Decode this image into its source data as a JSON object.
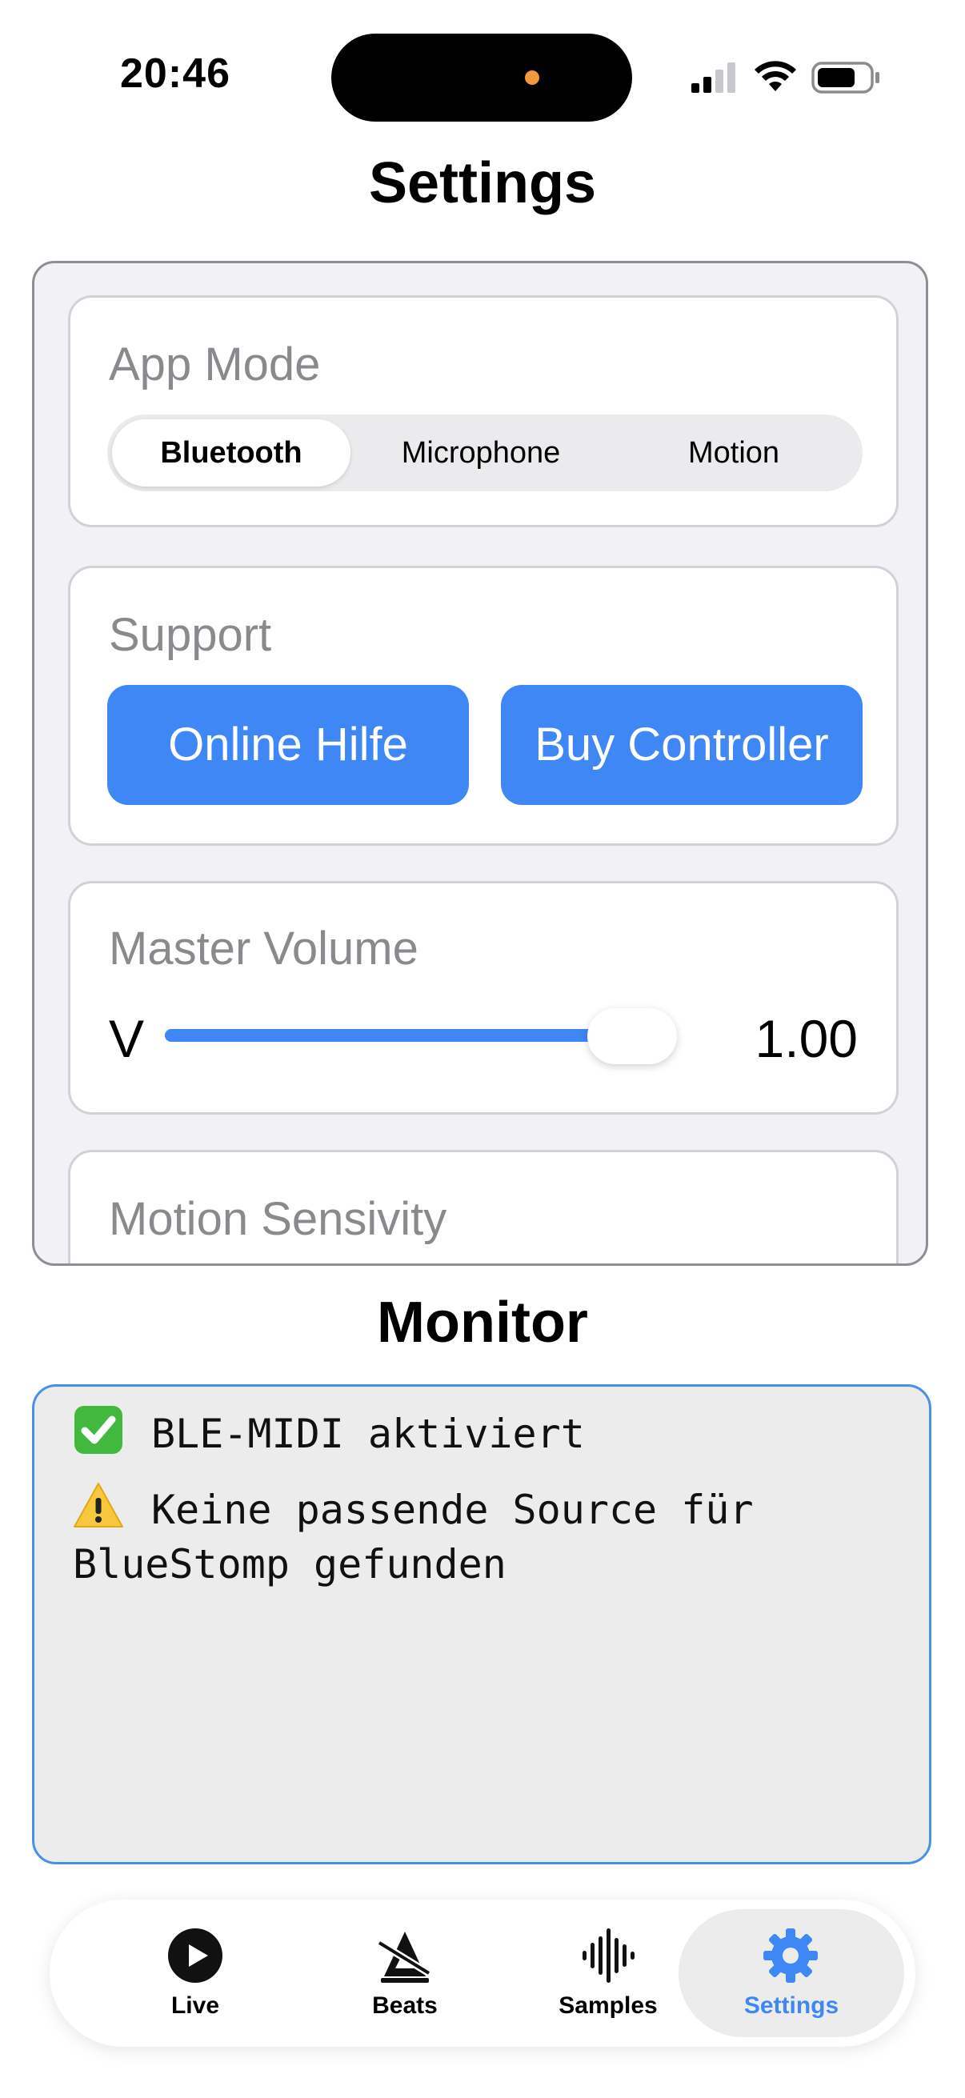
{
  "status_bar": {
    "time": "20:46"
  },
  "page": {
    "title": "Settings"
  },
  "settings": {
    "app_mode": {
      "label": "App Mode",
      "options": [
        "Bluetooth",
        "Microphone",
        "Motion"
      ],
      "selected": "Bluetooth"
    },
    "support": {
      "label": "Support",
      "online_help": "Online Hilfe",
      "buy_controller": "Buy Controller"
    },
    "master_volume": {
      "label": "Master Volume",
      "prefix": "V",
      "value_text": "1.00",
      "level": 1.0
    },
    "motion_sensitivity": {
      "label": "Motion Sensivity"
    }
  },
  "monitor": {
    "title": "Monitor",
    "lines": [
      {
        "icon": "check-mark-icon",
        "text": "BLE-MIDI aktiviert"
      },
      {
        "icon": "warning-icon",
        "text": "Keine passende Source für BlueStomp gefunden"
      }
    ]
  },
  "tab_bar": {
    "tabs": [
      {
        "label": "Live",
        "icon": "play-circle-icon"
      },
      {
        "label": "Beats",
        "icon": "metronome-icon"
      },
      {
        "label": "Samples",
        "icon": "waveform-icon"
      },
      {
        "label": "Settings",
        "icon": "gear-icon",
        "active": true
      }
    ]
  },
  "colors": {
    "accent": "#3f87f5",
    "card_background": "#ffffff",
    "panel_background": "#f2f2f6",
    "monitor_background": "#ececec"
  }
}
